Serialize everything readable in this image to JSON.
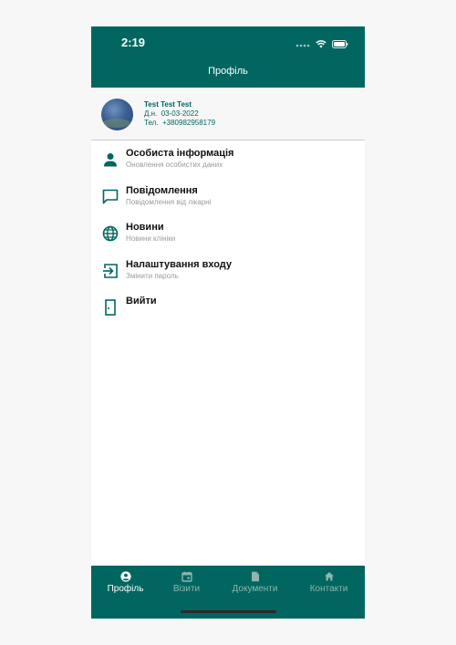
{
  "status_bar": {
    "time": "2:19"
  },
  "header": {
    "title": "Профіль"
  },
  "profile": {
    "name": "Test Test Test",
    "dob_label": "Д.н.",
    "dob": "03-03-2022",
    "phone_label": "Тел.",
    "phone": "+380982958179"
  },
  "menu": {
    "items": [
      {
        "title": "Особиста інформація",
        "subtitle": "Оновлення особистих даних",
        "icon": "person-icon"
      },
      {
        "title": "Повідомлення",
        "subtitle": "Повідомлення від лікарні",
        "icon": "message-icon"
      },
      {
        "title": "Новини",
        "subtitle": "Новини клініки",
        "icon": "globe-icon"
      },
      {
        "title": "Налаштування входу",
        "subtitle": "Змінити пароль",
        "icon": "login-icon"
      },
      {
        "title": "Вийти",
        "subtitle": "",
        "icon": "door-icon"
      }
    ]
  },
  "tabbar": {
    "tabs": [
      {
        "label": "Профіль",
        "active": true,
        "icon": "account-circle-icon"
      },
      {
        "label": "Візити",
        "active": false,
        "icon": "calendar-icon"
      },
      {
        "label": "Документи",
        "active": false,
        "icon": "document-icon"
      },
      {
        "label": "Контакти",
        "active": false,
        "icon": "home-icon"
      }
    ]
  },
  "colors": {
    "brand": "#00665f",
    "inactive_tab": "#8fb5b1",
    "subtitle": "#9a9a9a"
  }
}
